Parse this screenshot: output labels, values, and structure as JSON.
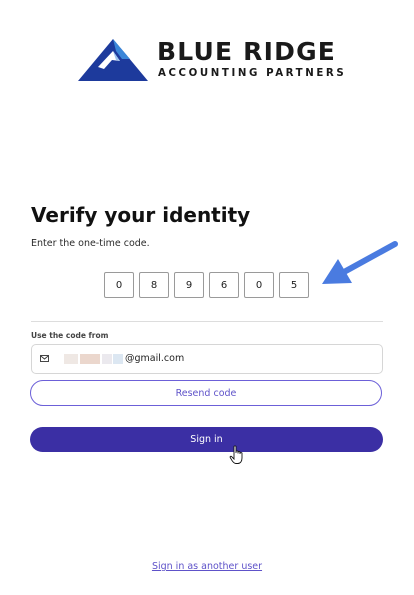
{
  "brand": {
    "name": "BLUE RIDGE",
    "tagline": "ACCOUNTING PARTNERS",
    "logo_icon": "mountain-logo-icon",
    "colors": {
      "primary": "#1d3a9c",
      "accent": "#3b86d8"
    }
  },
  "verify": {
    "title": "Verify your identity",
    "instructions": "Enter the one-time code.",
    "code_digits": [
      "0",
      "8",
      "9",
      "6",
      "0",
      "5"
    ],
    "arrow_icon": "arrow-pointer-icon",
    "arrow_color": "#4a7be0"
  },
  "delivery": {
    "label": "Use the code from",
    "email_icon": "mail-icon",
    "email_visible_suffix": "@gmail.com"
  },
  "actions": {
    "resend_label": "Resend code",
    "signin_label": "Sign in",
    "other_user_label": "Sign in as another user",
    "signin_color": "#3b2fa4",
    "link_color": "#5e52c9"
  },
  "cursor": {
    "icon": "hand-pointer-icon"
  }
}
